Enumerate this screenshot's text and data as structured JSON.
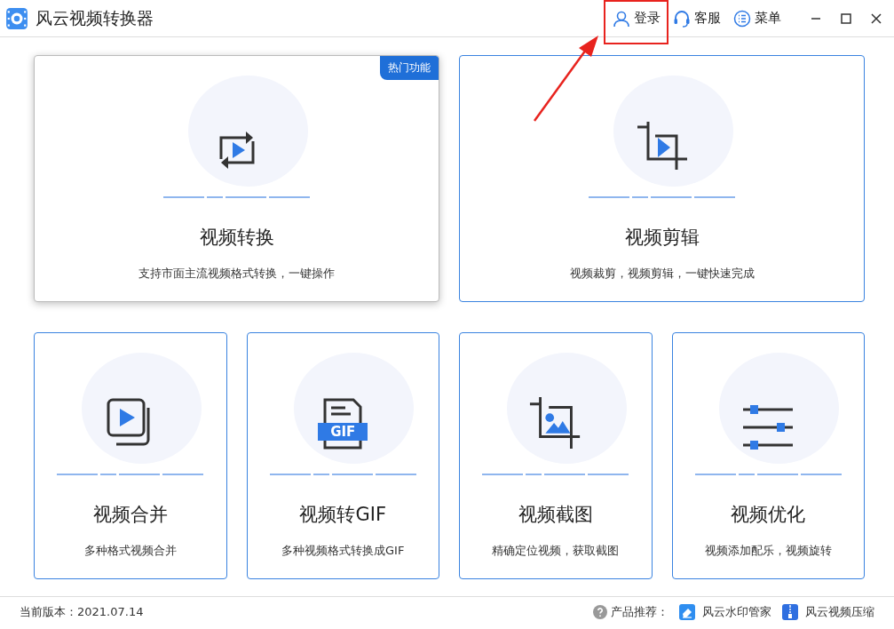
{
  "window": {
    "title": "风云视频转换器"
  },
  "header_actions": [
    {
      "kind": "user",
      "label": "登录"
    },
    {
      "kind": "support",
      "label": "客服"
    },
    {
      "kind": "menu",
      "label": "菜单"
    }
  ],
  "features": [
    {
      "kind": "convert",
      "title": "视频转换",
      "description": "支持市面主流视频格式转换，一键操作",
      "badge": "热门功能",
      "selected": true
    },
    {
      "kind": "edit",
      "title": "视频剪辑",
      "description": "视频裁剪，视频剪辑，一键快速完成",
      "selected": false
    },
    {
      "kind": "merge",
      "title": "视频合并",
      "description": "多种格式视频合并",
      "selected": false
    },
    {
      "kind": "gif",
      "title": "视频转GIF",
      "description": "多种视频格式转换成GIF",
      "icon_label": "GIF",
      "selected": false
    },
    {
      "kind": "screenshot",
      "title": "视频截图",
      "description": "精确定位视频，获取截图",
      "selected": false
    },
    {
      "kind": "optimize",
      "title": "视频优化",
      "description": "视频添加配乐，视频旋转",
      "selected": false
    }
  ],
  "footer": {
    "version": "当前版本：2021.07.14",
    "recommend_label": "产品推荐：",
    "products": [
      {
        "kind": "watermark",
        "name": "风云水印管家"
      },
      {
        "kind": "compress",
        "name": "风云视频压缩"
      }
    ]
  }
}
